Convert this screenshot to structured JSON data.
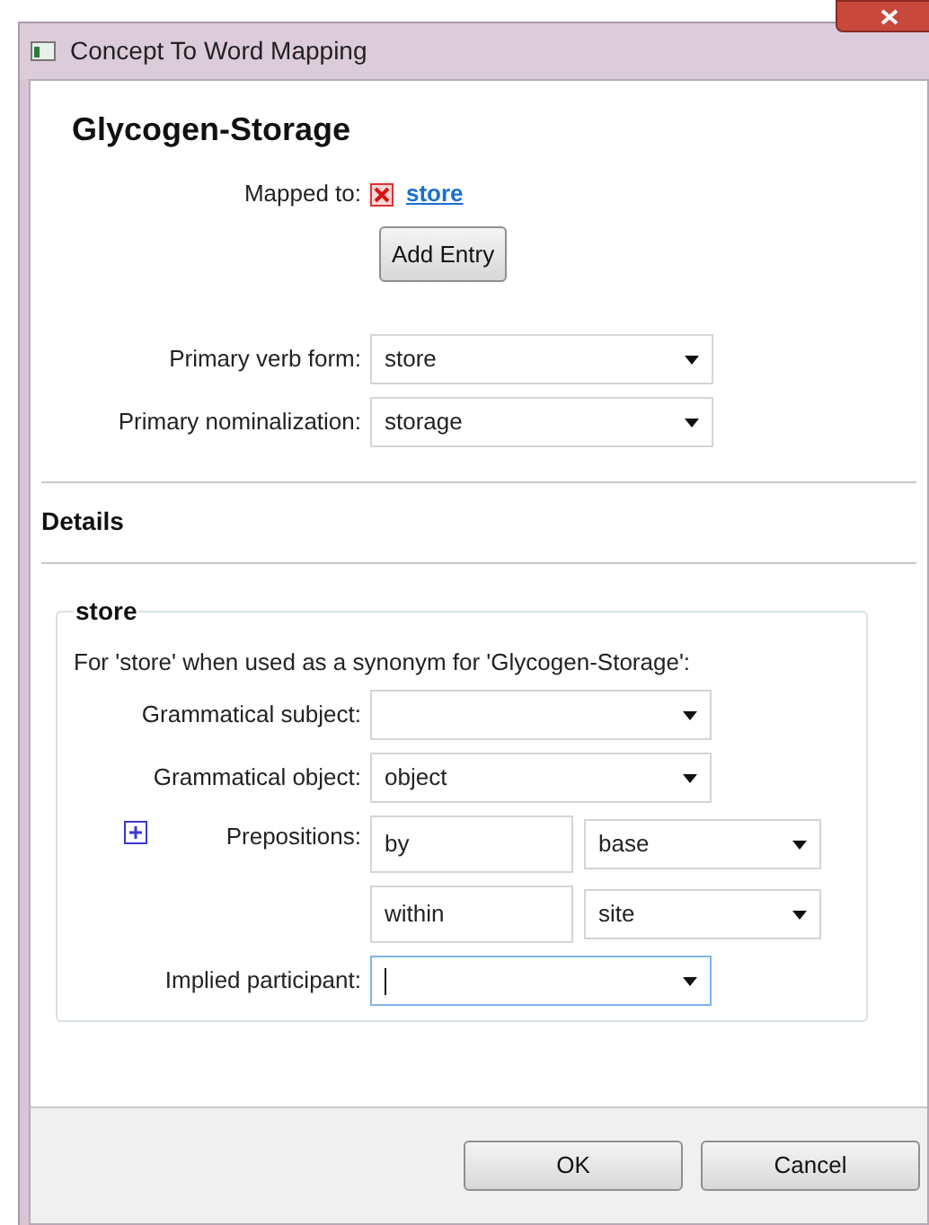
{
  "window": {
    "title": "Concept To Word Mapping"
  },
  "concept": {
    "title": "Glycogen-Storage",
    "mapped_label": "Mapped to:",
    "mapped_entries": [
      {
        "word": "store"
      }
    ],
    "add_button": "Add Entry"
  },
  "primary_fields": [
    {
      "label": "Primary verb form:",
      "value": "store"
    },
    {
      "label": "Primary nominalization:",
      "value": "storage"
    }
  ],
  "details": {
    "heading": "Details",
    "group": {
      "legend": "store",
      "description": "For 'store' when used as a synonym for 'Glycogen-Storage':",
      "fields": [
        {
          "kind": "combo",
          "label": "Grammatical subject:",
          "focused": false
        },
        {
          "kind": "combo",
          "label": "Grammatical object:",
          "value": "object",
          "focused": false
        },
        {
          "kind": "prepositions",
          "label": "Prepositions:",
          "items": [
            {
              "preposition": "by",
              "role": "base"
            },
            {
              "preposition": "within",
              "role": "site"
            }
          ]
        },
        {
          "kind": "combo",
          "label": "Implied participant:",
          "focused": true
        }
      ]
    }
  },
  "buttons": [
    {
      "label": "OK"
    },
    {
      "label": "Cancel"
    }
  ]
}
